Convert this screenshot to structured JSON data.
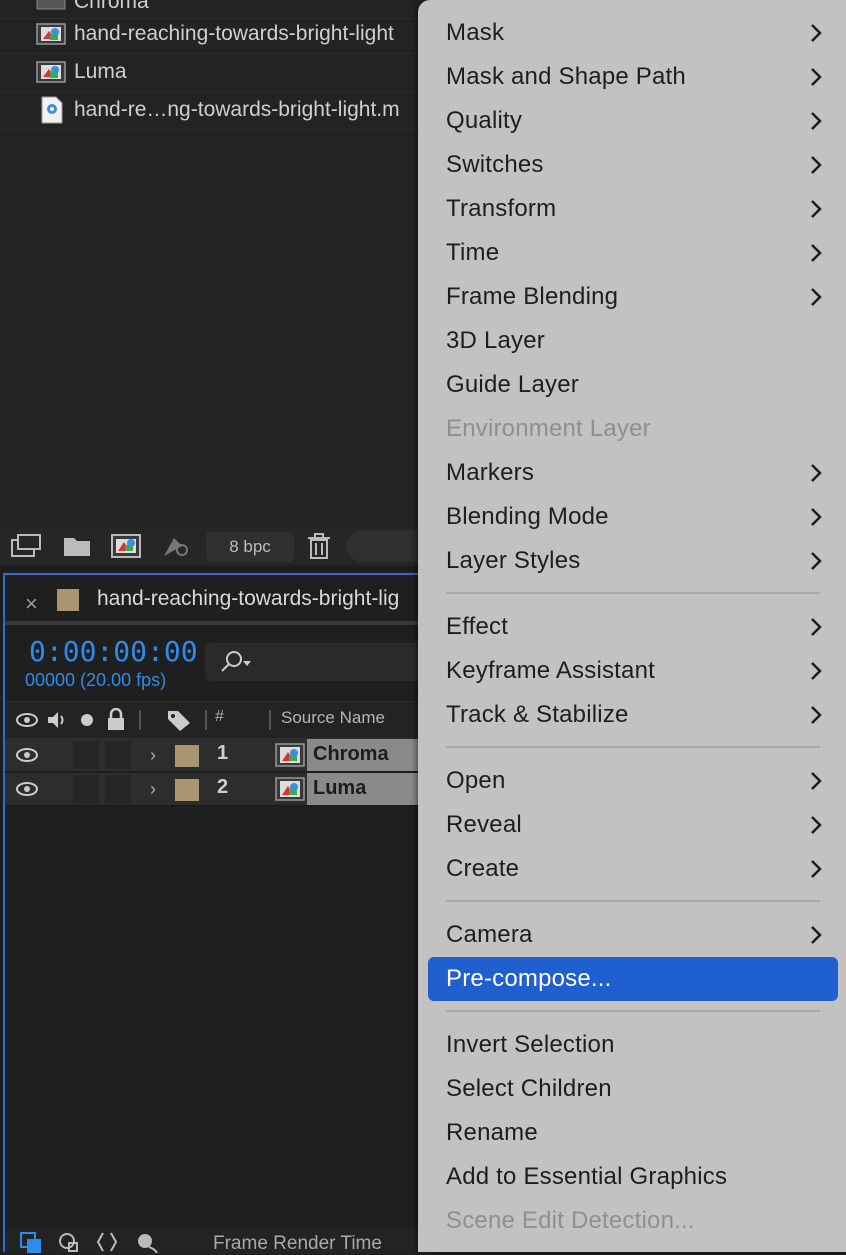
{
  "project": {
    "items": [
      {
        "name": "Chroma",
        "type": "composition"
      },
      {
        "name": "hand-reaching-towards-bright-light",
        "type": "composition"
      },
      {
        "name": "Luma",
        "type": "composition"
      },
      {
        "name": "hand-re…ng-towards-bright-light.m",
        "type": "footage"
      }
    ],
    "bpc": "8 bpc"
  },
  "timeline": {
    "close_glyph": "×",
    "comp_title": "hand-reaching-towards-bright-lig",
    "timecode": "0:00:00:00",
    "frame_info": "00000 (20.00 fps)",
    "header": {
      "hash": "#",
      "source_name": "Source Name"
    },
    "layers": [
      {
        "number": "1",
        "name": "Chroma"
      },
      {
        "number": "2",
        "name": "Luma"
      }
    ],
    "footer": {
      "frame_render_time": "Frame Render Time"
    }
  },
  "menu": {
    "items": [
      {
        "label": "Mask",
        "submenu": true
      },
      {
        "label": "Mask and Shape Path",
        "submenu": true
      },
      {
        "label": "Quality",
        "submenu": true
      },
      {
        "label": "Switches",
        "submenu": true
      },
      {
        "label": "Transform",
        "submenu": true
      },
      {
        "label": "Time",
        "submenu": true
      },
      {
        "label": "Frame Blending",
        "submenu": true
      },
      {
        "label": "3D Layer",
        "submenu": false
      },
      {
        "label": "Guide Layer",
        "submenu": false
      },
      {
        "label": "Environment Layer",
        "submenu": false,
        "disabled": true
      },
      {
        "label": "Markers",
        "submenu": true
      },
      {
        "label": "Blending Mode",
        "submenu": true
      },
      {
        "label": "Layer Styles",
        "submenu": true
      },
      {
        "label": "Effect",
        "submenu": true
      },
      {
        "label": "Keyframe Assistant",
        "submenu": true
      },
      {
        "label": "Track & Stabilize",
        "submenu": true
      },
      {
        "label": "Open",
        "submenu": true
      },
      {
        "label": "Reveal",
        "submenu": true
      },
      {
        "label": "Create",
        "submenu": true
      },
      {
        "label": "Camera",
        "submenu": true
      },
      {
        "label": "Pre-compose...",
        "submenu": false,
        "highlighted": true
      },
      {
        "label": "Invert Selection",
        "submenu": false
      },
      {
        "label": "Select Children",
        "submenu": false
      },
      {
        "label": "Rename",
        "submenu": false
      },
      {
        "label": "Add to Essential Graphics",
        "submenu": false
      },
      {
        "label": "Scene Edit Detection...",
        "submenu": false,
        "disabled": true
      }
    ]
  },
  "colors": {
    "accent": "#2f8bea",
    "highlight": "#1f5fd0",
    "menu_bg": "#c2c2c2",
    "label_swatch": "#a99670"
  }
}
